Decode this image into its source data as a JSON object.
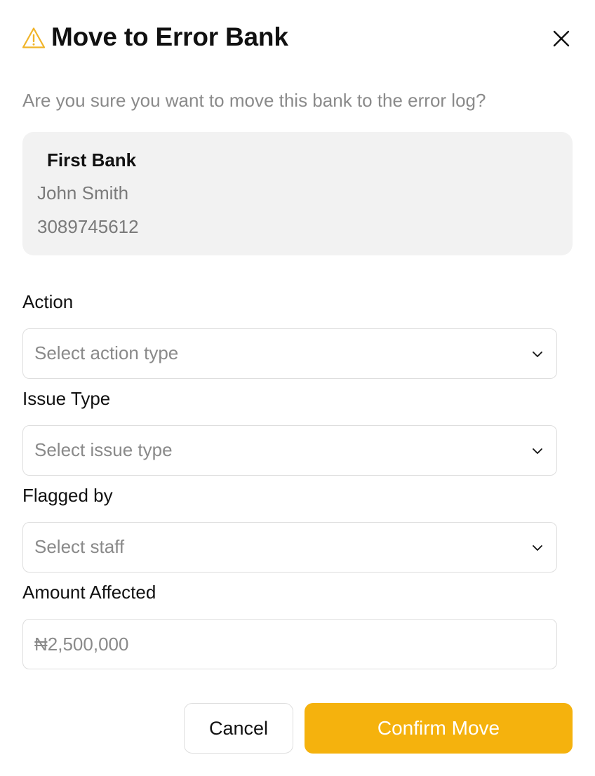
{
  "header": {
    "title": "Move to Error Bank",
    "warning_icon": "warning-triangle-icon",
    "close_icon": "close-icon"
  },
  "subtitle": "Are you sure you want to move this bank to the error log?",
  "bank": {
    "name": "First Bank",
    "account_holder": "John Smith",
    "account_number": "3089745612"
  },
  "fields": {
    "action": {
      "label": "Action",
      "placeholder": "Select action type"
    },
    "issue_type": {
      "label": "Issue Type",
      "placeholder": "Select issue type"
    },
    "flagged_by": {
      "label": "Flagged by",
      "placeholder": "Select staff"
    },
    "amount_affected": {
      "label": "Amount Affected",
      "placeholder": "₦2,500,000",
      "value": ""
    }
  },
  "buttons": {
    "cancel": "Cancel",
    "confirm": "Confirm Move"
  },
  "colors": {
    "accent": "#f5b20d",
    "warning_icon": "#f0b429",
    "card_background": "#f2f2f2",
    "muted_text": "#8a8a8a"
  }
}
